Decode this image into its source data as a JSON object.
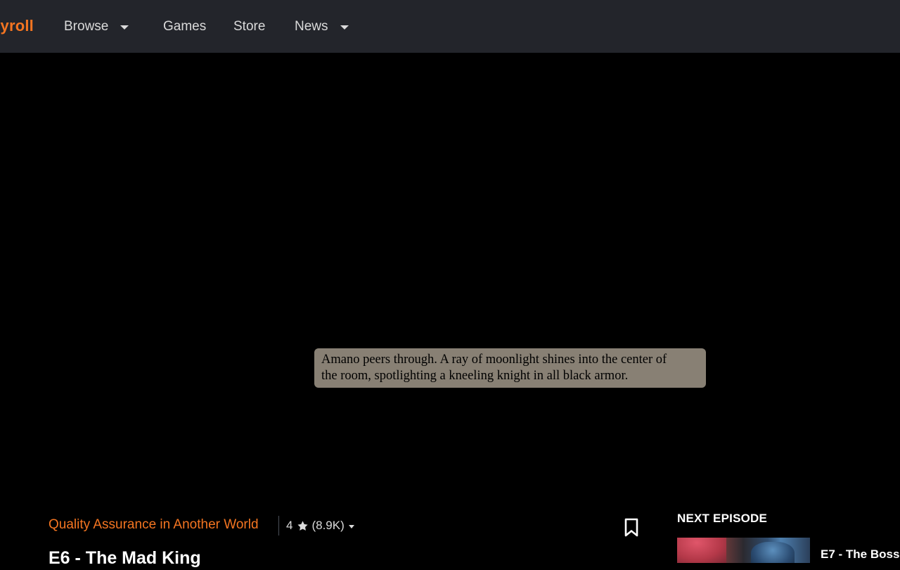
{
  "header": {
    "logo_text": "crunchyroll",
    "nav": [
      {
        "label": "Browse",
        "has_dropdown": true
      },
      {
        "label": "Games",
        "has_dropdown": false
      },
      {
        "label": "Store",
        "has_dropdown": false
      },
      {
        "label": "News",
        "has_dropdown": true
      }
    ]
  },
  "player": {
    "subtitle_line1": "Amano peers through. A ray of moonlight shines into the center of",
    "subtitle_line2": "the room, spotlighting a kneeling knight in all black armor."
  },
  "info": {
    "series_title": "Quality Assurance in Another World",
    "rating_value": "4",
    "rating_count": "(8.9K)",
    "episode_title": "E6 - The Mad King"
  },
  "next_episode": {
    "heading": "NEXT EPISODE",
    "title": "E7 - The Boss"
  },
  "colors": {
    "accent": "#f47521",
    "header_bg": "#23252b",
    "text_light": "#dadada"
  },
  "icons": {
    "rating": "star-icon",
    "bookmark": "bookmark-icon",
    "dropdown": "chevron-down-icon"
  }
}
